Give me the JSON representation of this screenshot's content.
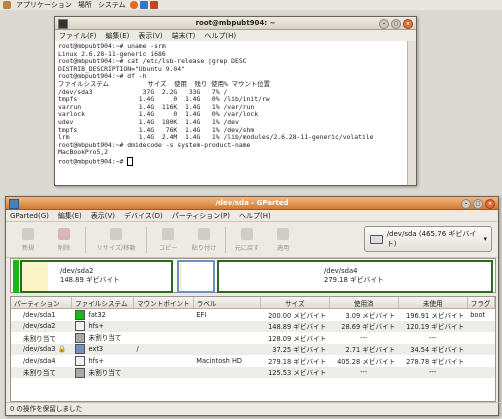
{
  "top_panel": {
    "menus": [
      "アプリケーション",
      "場所",
      "システム"
    ]
  },
  "terminal": {
    "title": "root@mbpubt904: ~",
    "menu": [
      "ファイル(F)",
      "編集(E)",
      "表示(V)",
      "端末(T)",
      "ヘルプ(H)"
    ],
    "lines": [
      "root@mbpubt904:~# uname -srm",
      "Linux 2.6.28-11-generic i686",
      "root@mbpubt904:~# cat /etc/lsb-release |grep DESC",
      "DISTRIB_DESCRIPTION=\"Ubuntu 9.04\"",
      "root@mbpubt904:~# df -h",
      "ファイルシステム          サイズ  使用  残り 使用% マウント位置",
      "/dev/sda3             37G  2.2G   33G   7% /",
      "tmpfs                1.4G     0  1.4G   0% /lib/init/rw",
      "varrun               1.4G  116K  1.4G   1% /var/run",
      "varlock              1.4G     0  1.4G   0% /var/lock",
      "udev                 1.4G  180K  1.4G   1% /dev",
      "tmpfs                1.4G   76K  1.4G   1% /dev/shm",
      "lrm                  1.4G  2.4M  1.4G   1% /lib/modules/2.6.28-11-generic/volatile",
      "root@mbpubt904:~# dmidecode -s system-product-name",
      "MacBookPro5,2"
    ],
    "prompt": "root@mbpubt904:~# "
  },
  "gparted": {
    "title": "/dev/sda - GParted",
    "menu": [
      "GParted(G)",
      "編集(E)",
      "表示(V)",
      "デバイス(D)",
      "パーティション(P)",
      "ヘルプ(H)"
    ],
    "toolbar": [
      "新規",
      "削除",
      "リサイズ/移動",
      "コピー",
      "貼り付け",
      "元に戻す",
      "適用"
    ],
    "device_selector": "/dev/sda  (465.76 ギビバイト)",
    "diskmap": {
      "left_label": "/dev/sda2",
      "left_size": "148.89 ギビバイト",
      "right_label": "/dev/sda4",
      "right_size": "279.18 ギビバイト"
    },
    "columns": [
      "パーティション",
      "ファイルシステム",
      "マウントポイント",
      "ラベル",
      "サイズ",
      "使用済",
      "未使用",
      "フラグ"
    ],
    "rows": [
      {
        "partition": "/dev/sda1",
        "fs": "fat32",
        "color": "#18b818",
        "mount": "",
        "label": "EFI",
        "size": "200.00 メビバイト",
        "used": "3.09 メビバイト",
        "unused": "196.91 メビバイト",
        "flags": "boot",
        "lock": false
      },
      {
        "partition": "/dev/sda2",
        "fs": "hfs+",
        "color": "#f2f2f2",
        "mount": "",
        "label": "",
        "size": "148.89 ギビバイト",
        "used": "28.69 ギビバイト",
        "unused": "120.19 ギビバイト",
        "flags": "",
        "lock": false
      },
      {
        "partition": "未割り当て",
        "fs": "未割り当て",
        "color": "#a8a8a8",
        "mount": "",
        "label": "",
        "size": "128.09 メビバイト",
        "used": "---",
        "unused": "---",
        "flags": "",
        "lock": false
      },
      {
        "partition": "/dev/sda3",
        "fs": "ext3",
        "color": "#7090c0",
        "mount": "/",
        "label": "",
        "size": "37.25 ギビバイト",
        "used": "2.71 ギビバイト",
        "unused": "34.54 ギビバイト",
        "flags": "",
        "lock": true
      },
      {
        "partition": "/dev/sda4",
        "fs": "hfs+",
        "color": "#f2f2f2",
        "mount": "",
        "label": "Macintosh HD",
        "size": "279.18 ギビバイト",
        "used": "405.28 メビバイト",
        "unused": "278.78 ギビバイト",
        "flags": "",
        "lock": false
      },
      {
        "partition": "未割り当て",
        "fs": "未割り当て",
        "color": "#a8a8a8",
        "mount": "",
        "label": "",
        "size": "125.53 メビバイト",
        "used": "---",
        "unused": "---",
        "flags": "",
        "lock": false
      }
    ],
    "status": "0 の操作を保留しました"
  }
}
